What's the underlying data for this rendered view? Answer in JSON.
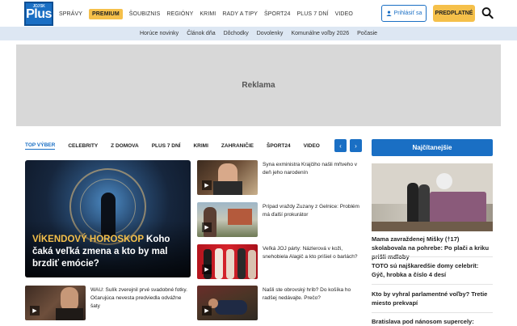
{
  "header": {
    "logo_small": "JOJ SK",
    "logo_big": "Plus",
    "nav_items": [
      "SPRÁVY",
      "PREMIUM",
      "ŠOUBIZNIS",
      "REGIÓNY",
      "KRIMI",
      "RADY A TIPY",
      "ŠPORT24",
      "PLUS 7 DNÍ",
      "VIDEO"
    ],
    "login_label": "Prihlásiť sa",
    "subscribe_label": "PREDPLATNÉ",
    "accent_color": "#1a6fc4",
    "premium_color": "#f5c04a"
  },
  "subnav": [
    "Horúce novinky",
    "Článok dňa",
    "Dôchodky",
    "Dovolenky",
    "Komunálne voľby 2026",
    "Počasie"
  ],
  "ad": {
    "label": "Reklama"
  },
  "tabs": [
    "TOP VÝBER",
    "CELEBRITY",
    "Z DOMOVA",
    "PLUS 7 DNÍ",
    "KRIMI",
    "ZAHRANIČIE",
    "ŠPORT24",
    "VIDEO"
  ],
  "hero": {
    "title_highlight": "VÍKENDOVÝ HOROSKOP",
    "title_rest": " Koho čaká veľká zmena a kto by mal brzdiť emócie?"
  },
  "articles": [
    {
      "text": "Syna exministra Krajčiho našli mŕtveho v deň jeho narodenín"
    },
    {
      "text": "Prípad vraždy Zuzany z Gelnice: Problém má ďalší prokurátor"
    },
    {
      "text": "Veľká JOJ párty: Názlerová v koži, snehobiela Alagič a kto prišiel o barlách?"
    },
    {
      "text": "WAU: Sulík zverejnil prvé svadobné fotky. Očarujúca nevesta predviedla odvážne šaty"
    },
    {
      "text": "Našli ste obrovský hríb? Do košíka ho radšej nedávajte. Prečo?"
    }
  ],
  "sidebar": {
    "heading": "Najčítanejšie",
    "items": [
      "Mama zavraždenej Mišky (†17) skolabovala na pohrebe: Po plači a kriku prišli mdloby",
      "TOTO sú najškaredšie domy celebrít: Gýč, hrobka a číslo 4 desí",
      "Kto by vyhral parlamentné voľby? Tretie miesto prekvapí",
      "Bratislava pod nánosom supercely:"
    ]
  }
}
